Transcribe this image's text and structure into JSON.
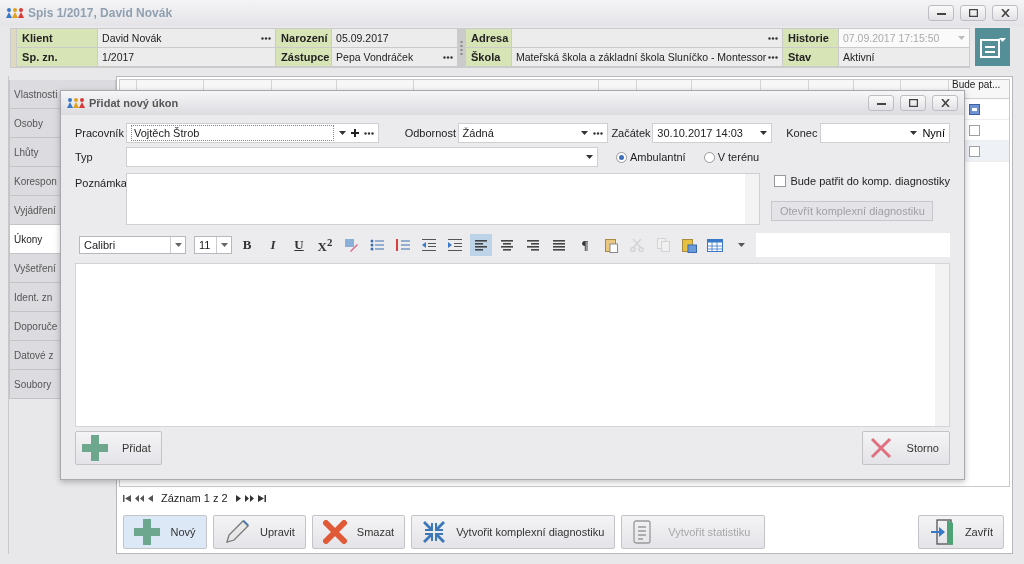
{
  "window": {
    "title": "Spis 1/2017, David Novák"
  },
  "header": {
    "rows": [
      [
        {
          "label": "Klient",
          "value": "David Novák",
          "kind": "lookup",
          "disabled": false
        },
        {
          "label": "Narození",
          "value": "05.09.2017",
          "kind": "text",
          "disabled": false
        },
        {
          "label": "Adresa",
          "kind": "lookup",
          "disabled": false
        },
        {
          "label": "Historie",
          "value": "07.09.2017 17:15:50",
          "kind": "dropdown",
          "disabled": true
        }
      ],
      [
        {
          "label": "Sp. zn.",
          "value": "1/2017",
          "kind": "text",
          "disabled": false
        },
        {
          "label": "Zástupce",
          "value": "Pepa Vondráček",
          "kind": "lookup",
          "disabled": false
        },
        {
          "label": "Škola",
          "value": "Mateřská škola a základní škola Sluníčko - Montessor",
          "kind": "lookup",
          "disabled": false
        },
        {
          "label": "Stav",
          "value": "Aktivní",
          "kind": "text",
          "disabled": false
        }
      ]
    ]
  },
  "sidebar": {
    "tabs": [
      {
        "label": "Vlastnosti",
        "selected": false
      },
      {
        "label": "Osoby",
        "selected": false
      },
      {
        "label": "Lhůty",
        "selected": false
      },
      {
        "label": "Korespon",
        "selected": false
      },
      {
        "label": "Vyjádření",
        "selected": false
      },
      {
        "label": "Úkony",
        "selected": true
      },
      {
        "label": "Vyšetření",
        "selected": false
      },
      {
        "label": "Ident. zn",
        "selected": false
      },
      {
        "label": "Doporuče",
        "selected": false
      },
      {
        "label": "Datové z",
        "selected": false
      },
      {
        "label": "Soubory",
        "selected": false
      }
    ]
  },
  "table": {
    "columns": [
      {
        "label": "Bude pat..."
      }
    ],
    "rows": [
      {
        "checked": true
      },
      {
        "checked": false
      },
      {
        "checked": false
      }
    ]
  },
  "pager": {
    "text": "Záznam 1 z 2"
  },
  "actions": [
    {
      "kind": "add",
      "label": "Nový",
      "disabled": false,
      "focused": true
    },
    {
      "kind": "edit",
      "label": "Upravit",
      "disabled": false,
      "focused": false
    },
    {
      "kind": "delete",
      "label": "Smazat",
      "disabled": false,
      "focused": false
    },
    {
      "kind": "diagnostics",
      "label": "Vytvořit komplexní diagnostiku",
      "disabled": false,
      "focused": false
    },
    {
      "kind": "statistics",
      "label": "Vytvořit statistiku",
      "disabled": true,
      "focused": false
    },
    {
      "kind": "close",
      "label": "Zavřít",
      "disabled": false,
      "focused": false
    }
  ],
  "dialog": {
    "title": "Přidat nový úkon",
    "worker": {
      "label": "Pracovník",
      "value": "Vojtěch Štrob"
    },
    "specialty": {
      "label": "Odbornost",
      "value": "Žádná"
    },
    "start": {
      "label": "Začátek",
      "value": "30.10.2017 14:03"
    },
    "end": {
      "label": "Konec",
      "now_label": "Nyní"
    },
    "type": {
      "label": "Typ"
    },
    "location": [
      {
        "label": "Ambulantní",
        "selected": true
      },
      {
        "label": "V terénu",
        "selected": false
      }
    ],
    "note": {
      "label": "Poznámka"
    },
    "diagnostics_checkbox": {
      "label": "Bude patřit do komp. diagnostiky",
      "checked": false
    },
    "open_diagnostics": {
      "label": "Otevřít komplexní diagnostiku",
      "disabled": true
    },
    "editor": {
      "font": "Calibri",
      "size": "11",
      "format": [
        {
          "kind": "bold",
          "label": "B"
        },
        {
          "kind": "italic",
          "label": "I"
        },
        {
          "kind": "underline",
          "label": "U"
        },
        {
          "kind": "superscript",
          "label": "X$^{2}$"
        }
      ],
      "lists": [
        {
          "kind": "highlight"
        },
        {
          "kind": "bullets"
        },
        {
          "kind": "numbering"
        },
        {
          "kind": "outdent"
        },
        {
          "kind": "indent"
        }
      ],
      "align": [
        {
          "kind": "left",
          "selected": true
        },
        {
          "kind": "center",
          "selected": false
        },
        {
          "kind": "right",
          "selected": false
        },
        {
          "kind": "justify",
          "selected": false
        }
      ],
      "pilcrow": "¶",
      "tools": [
        {
          "kind": "paste",
          "disabled": false
        },
        {
          "kind": "cut",
          "disabled": true
        },
        {
          "kind": "copy",
          "disabled": true
        },
        {
          "kind": "paste-special",
          "disabled": false
        },
        {
          "kind": "table",
          "disabled": false
        }
      ]
    },
    "buttons": [
      {
        "kind": "add",
        "label": "Přidat"
      },
      {
        "kind": "cancel",
        "label": "Storno"
      }
    ]
  }
}
